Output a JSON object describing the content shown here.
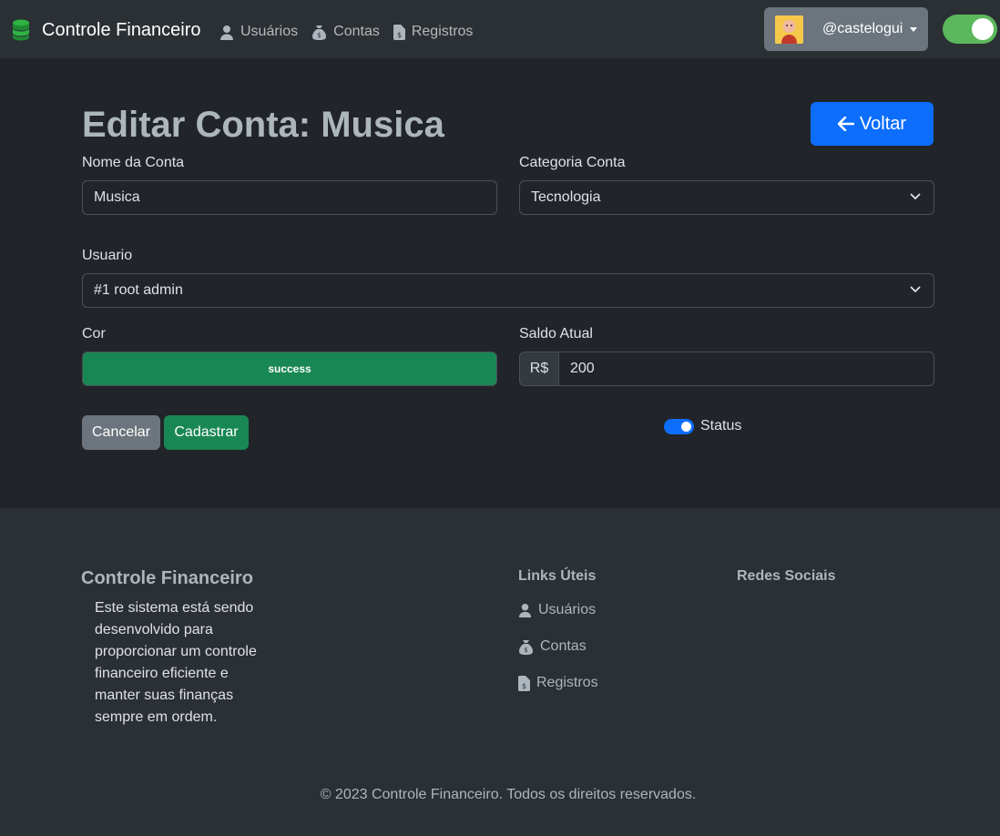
{
  "navbar": {
    "brand": "Controle Financeiro",
    "links": [
      {
        "label": "Usuários",
        "icon": "user-icon"
      },
      {
        "label": "Contas",
        "icon": "money-bag-icon"
      },
      {
        "label": "Registros",
        "icon": "file-invoice-dollar-icon"
      }
    ],
    "username": "@castelogui",
    "theme_toggle_on": true
  },
  "page": {
    "title": "Editar Conta: Musica",
    "back_label": "Voltar"
  },
  "form": {
    "nome_label": "Nome da Conta",
    "nome_value": "Musica",
    "categoria_label": "Categoria Conta",
    "categoria_value": "Tecnologia",
    "usuario_label": "Usuario",
    "usuario_value": "#1 root admin",
    "cor_label": "Cor",
    "cor_value": "success",
    "saldo_label": "Saldo Atual",
    "saldo_prefix": "R$",
    "saldo_value": "200",
    "cancel_label": "Cancelar",
    "submit_label": "Cadastrar",
    "status_label": "Status",
    "status_on": true
  },
  "footer": {
    "title": "Controle Financeiro",
    "description": "Este sistema está sendo desenvolvido para proporcionar um controle financeiro eficiente e manter suas finanças sempre em ordem.",
    "links_title": "Links Úteis",
    "links": [
      "Usuários",
      "Contas",
      "Registros"
    ],
    "social_title": "Redes Sociais",
    "copyright": "© 2023 Controle Financeiro. Todos os direitos reservados."
  },
  "colors": {
    "primary": "#0d6efd",
    "success": "#198754",
    "secondary": "#6c757d",
    "toggle": "#5cb85c"
  }
}
